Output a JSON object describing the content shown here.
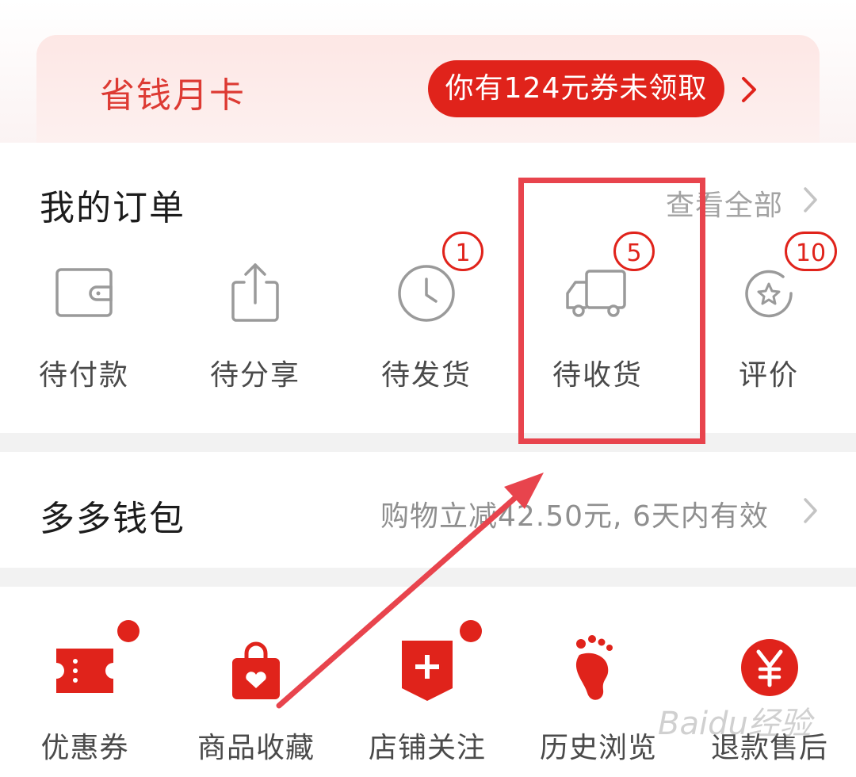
{
  "promo": {
    "title": "省钱月卡",
    "button_label": "你有124元券未领取"
  },
  "orders": {
    "title": "我的订单",
    "view_all": "查看全部",
    "items": [
      {
        "label": "待付款",
        "icon": "wallet-icon",
        "badge": ""
      },
      {
        "label": "待分享",
        "icon": "share-icon",
        "badge": ""
      },
      {
        "label": "待发货",
        "icon": "clock-icon",
        "badge": "1"
      },
      {
        "label": "待收货",
        "icon": "truck-icon",
        "badge": "5"
      },
      {
        "label": "评价",
        "icon": "star-review-icon",
        "badge": "10"
      }
    ]
  },
  "wallet": {
    "title": "多多钱包",
    "description": "购物立减42.50元, 6天内有效"
  },
  "tools": {
    "items": [
      {
        "label": "优惠券",
        "icon": "coupon-icon",
        "dot": true
      },
      {
        "label": "商品收藏",
        "icon": "bag-heart-icon",
        "dot": false
      },
      {
        "label": "店铺关注",
        "icon": "store-plus-icon",
        "dot": true
      },
      {
        "label": "历史浏览",
        "icon": "footprint-icon",
        "dot": false
      },
      {
        "label": "退款售后",
        "icon": "yuan-icon",
        "dot": false
      }
    ]
  },
  "watermark": "Baidu经验",
  "colors": {
    "brand_red": "#e0231b",
    "annotation_red": "#e8444d",
    "icon_gray": "#9a9a9a",
    "promo_bg": "#fde7e5"
  }
}
